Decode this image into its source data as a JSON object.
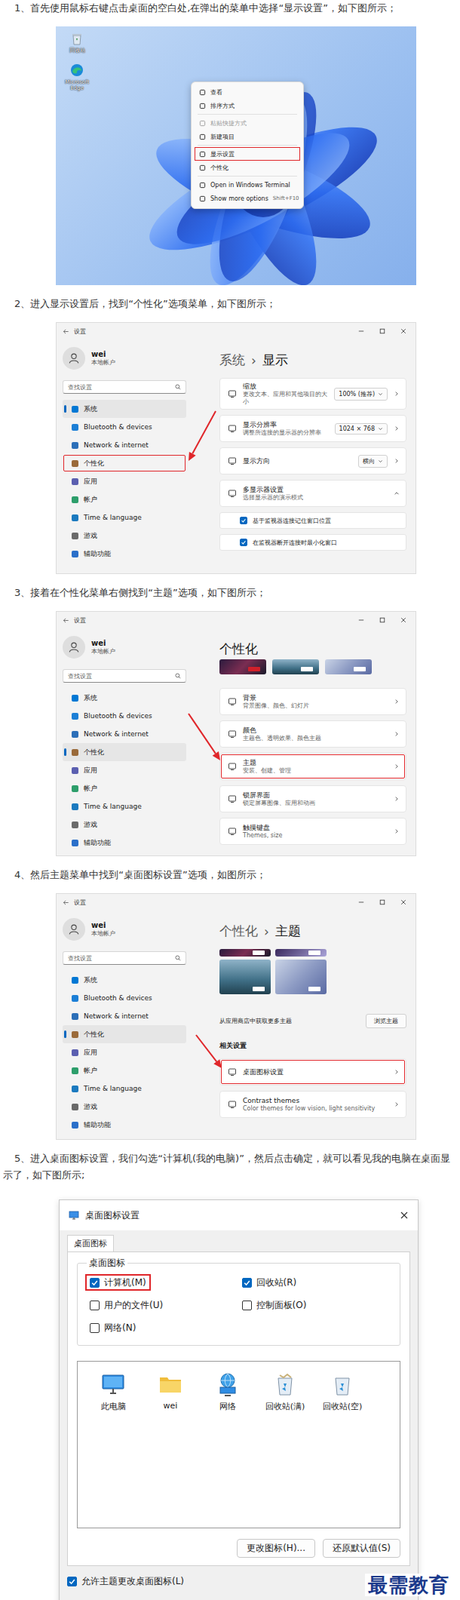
{
  "steps": [
    {
      "kind": "desktop",
      "text_lines": [
        "1、首先使用鼠标右键点击桌面的空白处,在弹出的菜单中选择“显示设置”，如下图所示；"
      ],
      "desktop_icons": [
        {
          "label": "回收站",
          "kind": "recycle-bin"
        },
        {
          "label": "Microsoft Edge",
          "kind": "browser"
        }
      ],
      "menu": [
        {
          "label": "查看",
          "disabled": false,
          "highlighted": false,
          "separator_before": false
        },
        {
          "label": "排序方式",
          "disabled": false,
          "highlighted": false,
          "separator_before": false
        },
        {
          "label": "粘贴快捷方式",
          "disabled": true,
          "highlighted": false,
          "separator_before": true
        },
        {
          "label": "新建项目",
          "disabled": false,
          "highlighted": false,
          "separator_before": false
        },
        {
          "label": "显示设置",
          "disabled": false,
          "highlighted": true,
          "separator_before": true
        },
        {
          "label": "个性化",
          "disabled": false,
          "highlighted": false,
          "separator_before": false
        },
        {
          "label": "Open in Windows Terminal",
          "disabled": false,
          "highlighted": false,
          "separator_before": true
        },
        {
          "label": "Show more options",
          "shortcut": "Shift+F10",
          "disabled": false,
          "highlighted": false,
          "separator_before": false
        }
      ]
    },
    {
      "kind": "settings",
      "text_lines": [
        "2、进入显示设置后，找到“个性化”选项菜单，如下图所示；"
      ],
      "window": {
        "title": "设置",
        "user": "wei",
        "account": "本地帐户",
        "search": "查找设置",
        "nav": [
          {
            "label": "系统",
            "selected": true,
            "highlighted": false
          },
          {
            "label": "Bluetooth & devices",
            "selected": false,
            "highlighted": false
          },
          {
            "label": "Network & internet",
            "selected": false,
            "highlighted": false
          },
          {
            "label": "个性化",
            "selected": false,
            "highlighted": true
          },
          {
            "label": "应用",
            "selected": false,
            "highlighted": false
          },
          {
            "label": "帐户",
            "selected": false,
            "highlighted": false
          },
          {
            "label": "Time & language",
            "selected": false,
            "highlighted": false
          },
          {
            "label": "游戏",
            "selected": false,
            "highlighted": false
          },
          {
            "label": "辅助功能",
            "selected": false,
            "highlighted": false
          }
        ],
        "breadcrumb": [
          "系统",
          "显示"
        ],
        "separator": "›",
        "cards": [
          {
            "kind": "select",
            "title": "缩放",
            "subtitle": "更改文本、应用和其他项目的大小",
            "value": "100% (推荐)",
            "highlighted": false
          },
          {
            "kind": "select",
            "title": "显示分辨率",
            "subtitle": "调整所连接的显示器的分辨率",
            "value": "1024 × 768",
            "highlighted": false
          },
          {
            "kind": "select",
            "title": "显示方向",
            "value": "横向",
            "highlighted": false
          },
          {
            "kind": "expander",
            "title": "多显示器设置",
            "subtitle": "选择显示器的演示模式",
            "expanded": true,
            "highlighted": false
          },
          {
            "kind": "check",
            "label": "基于监视器连接记住窗口位置",
            "checked": true
          },
          {
            "kind": "check",
            "label": "在监视器断开连接时最小化窗口",
            "checked": true
          }
        ]
      }
    },
    {
      "kind": "settings",
      "text_lines": [
        "3、接着在个性化菜单右侧找到“主题”选项，如下图所示；"
      ],
      "window": {
        "title": "设置",
        "user": "wei",
        "account": "本地帐户",
        "search": "查找设置",
        "nav": [
          {
            "label": "系统",
            "selected": false,
            "highlighted": false
          },
          {
            "label": "Bluetooth & devices",
            "selected": false,
            "highlighted": false
          },
          {
            "label": "Network & internet",
            "selected": false,
            "highlighted": false
          },
          {
            "label": "个性化",
            "selected": true,
            "highlighted": false
          },
          {
            "label": "应用",
            "selected": false,
            "highlighted": false
          },
          {
            "label": "帐户",
            "selected": false,
            "highlighted": false
          },
          {
            "label": "Time & language",
            "selected": false,
            "highlighted": false
          },
          {
            "label": "游戏",
            "selected": false,
            "highlighted": false
          },
          {
            "label": "辅助功能",
            "selected": false,
            "highlighted": false
          }
        ],
        "breadcrumb": [
          "个性化"
        ],
        "cards": [
          {
            "kind": "theme_strip"
          },
          {
            "kind": "link",
            "title": "背景",
            "subtitle": "背景图像、颜色、幻灯片",
            "highlighted": false
          },
          {
            "kind": "link",
            "title": "颜色",
            "subtitle": "主题色、透明效果、颜色主题",
            "highlighted": false
          },
          {
            "kind": "link",
            "title": "主题",
            "subtitle": "安装、创建、管理",
            "highlighted": true
          },
          {
            "kind": "link",
            "title": "锁屏界面",
            "subtitle": "锁定屏幕图像、应用和动画",
            "highlighted": false
          },
          {
            "kind": "link",
            "title": "触摸键盘",
            "subtitle": "Themes, size",
            "highlighted": false
          }
        ]
      }
    },
    {
      "kind": "settings",
      "text_lines": [
        "4、然后主题菜单中找到“桌面图标设置”选项，如图所示；"
      ],
      "window": {
        "title": "设置",
        "user": "wei",
        "account": "本地帐户",
        "search": "查找设置",
        "nav": [
          {
            "label": "系统",
            "selected": false,
            "highlighted": false
          },
          {
            "label": "Bluetooth & devices",
            "selected": false,
            "highlighted": false
          },
          {
            "label": "Network & internet",
            "selected": false,
            "highlighted": false
          },
          {
            "label": "个性化",
            "selected": true,
            "highlighted": false
          },
          {
            "label": "应用",
            "selected": false,
            "highlighted": false
          },
          {
            "label": "帐户",
            "selected": false,
            "highlighted": false
          },
          {
            "label": "Time & language",
            "selected": false,
            "highlighted": false
          },
          {
            "label": "游戏",
            "selected": false,
            "highlighted": false
          },
          {
            "label": "辅助功能",
            "selected": false,
            "highlighted": false
          }
        ],
        "breadcrumb": [
          "个性化",
          "主题"
        ],
        "separator": "›",
        "cards": [
          {
            "kind": "theme_grid"
          },
          {
            "kind": "store",
            "text": "从应用商店中获取更多主题",
            "button": "浏览主题"
          },
          {
            "kind": "heading",
            "text": "相关设置"
          },
          {
            "kind": "link",
            "title": "桌面图标设置",
            "highlighted": true
          },
          {
            "kind": "link",
            "title": "Contrast themes",
            "subtitle": "Color themes for low vision, light sensitivity",
            "highlighted": false
          }
        ]
      }
    },
    {
      "kind": "dialog",
      "text_lines": [
        "5、进入桌面图标设置，我们勾选“计算机(我的电脑)”，然后点击确定，就可以看见我的电脑在桌面显",
        "示了，如下图所示;"
      ],
      "dialog": {
        "title": "桌面图标设置",
        "tabs": [
          {
            "label": "桌面图标",
            "selected": true
          }
        ],
        "group": "桌面图标",
        "checkboxes": [
          {
            "label": "计算机(M)",
            "checked": true,
            "highlighted": true
          },
          {
            "label": "回收站(R)",
            "checked": true,
            "highlighted": false
          },
          {
            "label": "用户的文件(U)",
            "checked": false,
            "highlighted": false
          },
          {
            "label": "控制面板(O)",
            "checked": false,
            "highlighted": false
          },
          {
            "label": "网络(N)",
            "checked": false,
            "highlighted": false
          }
        ],
        "icons": [
          {
            "label": "此电脑",
            "kind": "pc"
          },
          {
            "label": "wei",
            "kind": "folder"
          },
          {
            "label": "网络",
            "kind": "network"
          },
          {
            "label": "回收站(满)",
            "kind": "bin-full"
          },
          {
            "label": "回收站(空)",
            "kind": "bin-empty"
          }
        ],
        "buttons": [
          "更改图标(H)...",
          "还原默认值(S)"
        ],
        "footer_check": {
          "label": "允许主题更改桌面图标(L)",
          "checked": true
        }
      }
    }
  ],
  "watermark": "最需教育"
}
